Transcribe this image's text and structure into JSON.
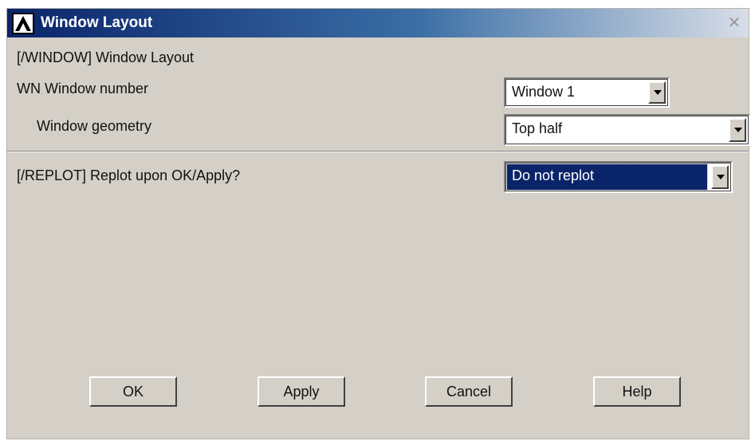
{
  "window": {
    "title": "Window Layout",
    "close_icon": "close-icon",
    "logo_icon": "ansys-logo-icon"
  },
  "form": {
    "section_label": "[/WINDOW]  Window Layout",
    "window_number": {
      "label": "WN  Window number",
      "value": "Window 1"
    },
    "window_geometry": {
      "label": "Window geometry",
      "value": "Top half"
    },
    "replot": {
      "label": "[/REPLOT]  Replot upon OK/Apply?",
      "value": "Do not replot"
    }
  },
  "buttons": {
    "ok": "OK",
    "apply": "Apply",
    "cancel": "Cancel",
    "help": "Help"
  },
  "colors": {
    "titlebar_start": "#0a246a",
    "dialog_bg": "#d4d0c8",
    "selection": "#0a246a"
  }
}
